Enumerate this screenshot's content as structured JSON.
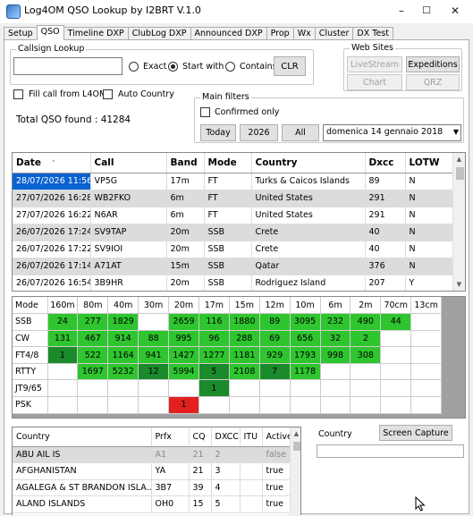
{
  "window": {
    "title": "Log4OM QSO Lookup by I2BRT V.1.0",
    "minimize": "–",
    "maximize": "☐",
    "close": "✕"
  },
  "tabs": [
    "Setup",
    "QSO",
    "Timeline DXP",
    "ClubLog DXP",
    "Announced DXP",
    "Prop",
    "Wx",
    "Cluster",
    "DX Test"
  ],
  "active_tab": "QSO",
  "callsign_lookup": {
    "label": "Callsign Lookup",
    "value": "",
    "exact": "Exact",
    "start_with": "Start with",
    "contains": "Contains",
    "selected": "Start with",
    "clr": "CLR"
  },
  "web_sites": {
    "label": "Web Sites",
    "livestream": "LiveStream",
    "expeditions": "Expeditions",
    "chart": "Chart",
    "qrz": "QRZ"
  },
  "fill_call": "Fill call from L4OM",
  "auto_country": "Auto Country",
  "main_filters": {
    "label": "Main filters",
    "confirmed_only": "Confirmed only",
    "today": "Today",
    "year": "2026",
    "all": "All",
    "date_value": "domenica 14  gennaio  2018"
  },
  "total_qso": "Total QSO found : 41284",
  "qso_table": {
    "headers": [
      "Date",
      "Call",
      "Band",
      "Mode",
      "Country",
      "Dxcc",
      "LOTW"
    ],
    "rows": [
      [
        "28/07/2026 11:56",
        "VP5G",
        "17m",
        "FT",
        "Turks & Caicos Islands",
        "89",
        "N"
      ],
      [
        "27/07/2026 16:28",
        "WB2FKO",
        "6m",
        "FT",
        "United States",
        "291",
        "N"
      ],
      [
        "27/07/2026 16:22",
        "N6AR",
        "6m",
        "FT",
        "United States",
        "291",
        "N"
      ],
      [
        "26/07/2026 17:24",
        "SV9TAP",
        "20m",
        "SSB",
        "Crete",
        "40",
        "N"
      ],
      [
        "26/07/2026 17:22",
        "SV9IOI",
        "20m",
        "SSB",
        "Crete",
        "40",
        "N"
      ],
      [
        "26/07/2026 17:14",
        "A71AT",
        "15m",
        "SSB",
        "Qatar",
        "376",
        "N"
      ],
      [
        "26/07/2026 16:54",
        "3B9HR",
        "20m",
        "SSB",
        "Rodriguez Island",
        "207",
        "Y"
      ]
    ]
  },
  "band_grid": {
    "bands": [
      "160m",
      "80m",
      "40m",
      "30m",
      "20m",
      "17m",
      "15m",
      "12m",
      "10m",
      "6m",
      "2m",
      "70cm",
      "13cm"
    ],
    "mode_header": "Mode",
    "rows": [
      {
        "mode": "SSB",
        "cells": [
          [
            "24",
            "lt"
          ],
          [
            "277",
            "lt"
          ],
          [
            "1829",
            "lt"
          ],
          [
            "",
            ""
          ],
          [
            "2659",
            "lt"
          ],
          [
            "116",
            "lt"
          ],
          [
            "1880",
            "lt"
          ],
          [
            "89",
            "lt"
          ],
          [
            "3095",
            "lt"
          ],
          [
            "232",
            "lt"
          ],
          [
            "490",
            "lt"
          ],
          [
            "44",
            "lt"
          ],
          [
            "",
            ""
          ]
        ]
      },
      {
        "mode": "CW",
        "cells": [
          [
            "131",
            "lt"
          ],
          [
            "467",
            "lt"
          ],
          [
            "914",
            "lt"
          ],
          [
            "88",
            "lt"
          ],
          [
            "995",
            "lt"
          ],
          [
            "96",
            "lt"
          ],
          [
            "288",
            "lt"
          ],
          [
            "69",
            "lt"
          ],
          [
            "656",
            "lt"
          ],
          [
            "32",
            "lt"
          ],
          [
            "2",
            "lt"
          ],
          [
            "",
            ""
          ],
          [
            "",
            ""
          ]
        ]
      },
      {
        "mode": "FT4/8",
        "cells": [
          [
            "1",
            "dk"
          ],
          [
            "522",
            "lt"
          ],
          [
            "1164",
            "lt"
          ],
          [
            "941",
            "lt"
          ],
          [
            "1427",
            "lt"
          ],
          [
            "1277",
            "lt"
          ],
          [
            "1181",
            "lt"
          ],
          [
            "929",
            "lt"
          ],
          [
            "1793",
            "lt"
          ],
          [
            "998",
            "lt"
          ],
          [
            "308",
            "lt"
          ],
          [
            "",
            ""
          ],
          [
            "",
            ""
          ]
        ]
      },
      {
        "mode": "RTTY",
        "cells": [
          [
            "",
            ""
          ],
          [
            "1697",
            "lt"
          ],
          [
            "5232",
            "lt"
          ],
          [
            "12",
            "dk"
          ],
          [
            "5994",
            "lt"
          ],
          [
            "5",
            "dk"
          ],
          [
            "2108",
            "lt"
          ],
          [
            "7",
            "dk"
          ],
          [
            "1178",
            "lt"
          ],
          [
            "",
            ""
          ],
          [
            "",
            ""
          ],
          [
            "",
            ""
          ],
          [
            "",
            ""
          ]
        ]
      },
      {
        "mode": "JT9/65",
        "cells": [
          [
            "",
            ""
          ],
          [
            "",
            ""
          ],
          [
            "",
            ""
          ],
          [
            "",
            ""
          ],
          [
            "",
            ""
          ],
          [
            "1",
            "dk"
          ],
          [
            "",
            ""
          ],
          [
            "",
            ""
          ],
          [
            "",
            ""
          ],
          [
            "",
            ""
          ],
          [
            "",
            ""
          ],
          [
            "",
            ""
          ],
          [
            "",
            ""
          ]
        ]
      },
      {
        "mode": "PSK",
        "cells": [
          [
            "",
            ""
          ],
          [
            "",
            ""
          ],
          [
            "",
            ""
          ],
          [
            "",
            ""
          ],
          [
            "1",
            "rd"
          ],
          [
            "",
            ""
          ],
          [
            "",
            ""
          ],
          [
            "",
            ""
          ],
          [
            "",
            ""
          ],
          [
            "",
            ""
          ],
          [
            "",
            ""
          ],
          [
            "",
            ""
          ],
          [
            "",
            ""
          ]
        ]
      }
    ]
  },
  "country_table": {
    "headers": [
      "Country",
      "Prfx",
      "CQ",
      "DXCC",
      "ITU",
      "Active"
    ],
    "rows": [
      [
        "ABU AIL IS",
        "A1",
        "21",
        "2",
        "",
        "false"
      ],
      [
        "AFGHANISTAN",
        "YA",
        "21",
        "3",
        "",
        "true"
      ],
      [
        "AGALEGA & ST BRANDON ISLA...",
        "3B7",
        "39",
        "4",
        "",
        "true"
      ],
      [
        "ALAND ISLANDS",
        "OH0",
        "15",
        "5",
        "",
        "true"
      ]
    ]
  },
  "country_box": {
    "label": "Country",
    "screen_capture": "Screen Capture",
    "value": ""
  }
}
